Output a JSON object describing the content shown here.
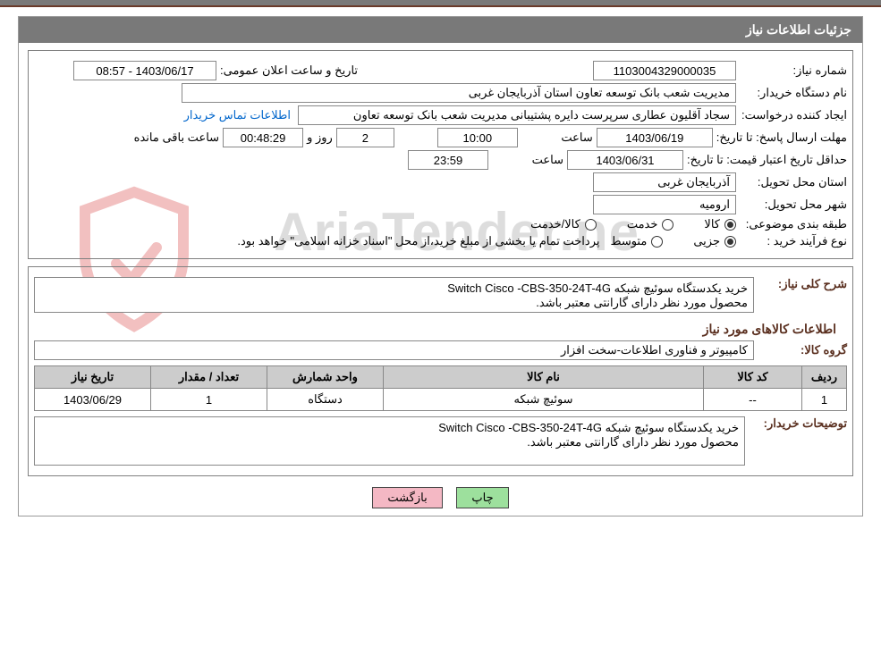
{
  "title": "جزئیات اطلاعات نیاز",
  "labels": {
    "need_no": "شماره نیاز:",
    "announce": "تاریخ و ساعت اعلان عمومی:",
    "buyer": "نام دستگاه خریدار:",
    "requester": "ایجاد کننده درخواست:",
    "contact_link": "اطلاعات تماس خریدار",
    "deadline": "مهلت ارسال پاسخ: تا تاریخ:",
    "time": "ساعت",
    "days_and": "روز و",
    "time_left": "ساعت باقی مانده",
    "validity": "حداقل تاریخ اعتبار قیمت: تا تاریخ:",
    "province": "استان محل تحویل:",
    "city": "شهر محل تحویل:",
    "category": "طبقه بندی موضوعی:",
    "cat_goods": "کالا",
    "cat_service": "خدمت",
    "cat_both": "کالا/خدمت",
    "process": "نوع فرآیند خرید :",
    "proc_partial": "جزیی",
    "proc_medium": "متوسط",
    "proc_note": "پرداخت تمام یا بخشی از مبلغ خرید،از محل \"اسناد خزانه اسلامی\" خواهد بود.",
    "desc": "شرح کلی نیاز:",
    "items_title": "اطلاعات کالاهای مورد نیاز",
    "group": "گروه کالا:",
    "buyer_notes": "توضیحات خریدار:"
  },
  "values": {
    "need_no": "1103004329000035",
    "announce": "1403/06/17 - 08:57",
    "buyer": "مدیریت شعب بانک توسعه تعاون استان آذربایجان غربی",
    "requester": "سجاد آقلیون عطاری سرپرست دایره پشتیبانی مدیریت شعب بانک توسعه تعاون",
    "deadline_date": "1403/06/19",
    "deadline_time": "10:00",
    "days_left": "2",
    "countdown": "00:48:29",
    "validity_date": "1403/06/31",
    "validity_time": "23:59",
    "province": "آذربایجان غربی",
    "city": "ارومیه",
    "description": "خرید یکدستگاه سوئیچ شبکه Switch Cisco -CBS-350-24T-4G\nمحصول مورد نظر دارای گارانتی معتبر باشد.",
    "group": "کامپیوتر و فناوری اطلاعات-سخت افزار",
    "buyer_notes": "خرید یکدستگاه سوئیچ شبکه Switch Cisco -CBS-350-24T-4G\nمحصول مورد نظر دارای گارانتی معتبر باشد."
  },
  "table": {
    "headers": {
      "row": "ردیف",
      "code": "کد کالا",
      "name": "نام کالا",
      "unit": "واحد شمارش",
      "qty": "تعداد / مقدار",
      "date": "تاریخ نیاز"
    },
    "data": {
      "row": "1",
      "code": "--",
      "name": "سوئیچ شبکه",
      "unit": "دستگاه",
      "qty": "1",
      "date": "1403/06/29"
    }
  },
  "buttons": {
    "print": "چاپ",
    "back": "بازگشت"
  },
  "watermark": "AriaTender.ne"
}
